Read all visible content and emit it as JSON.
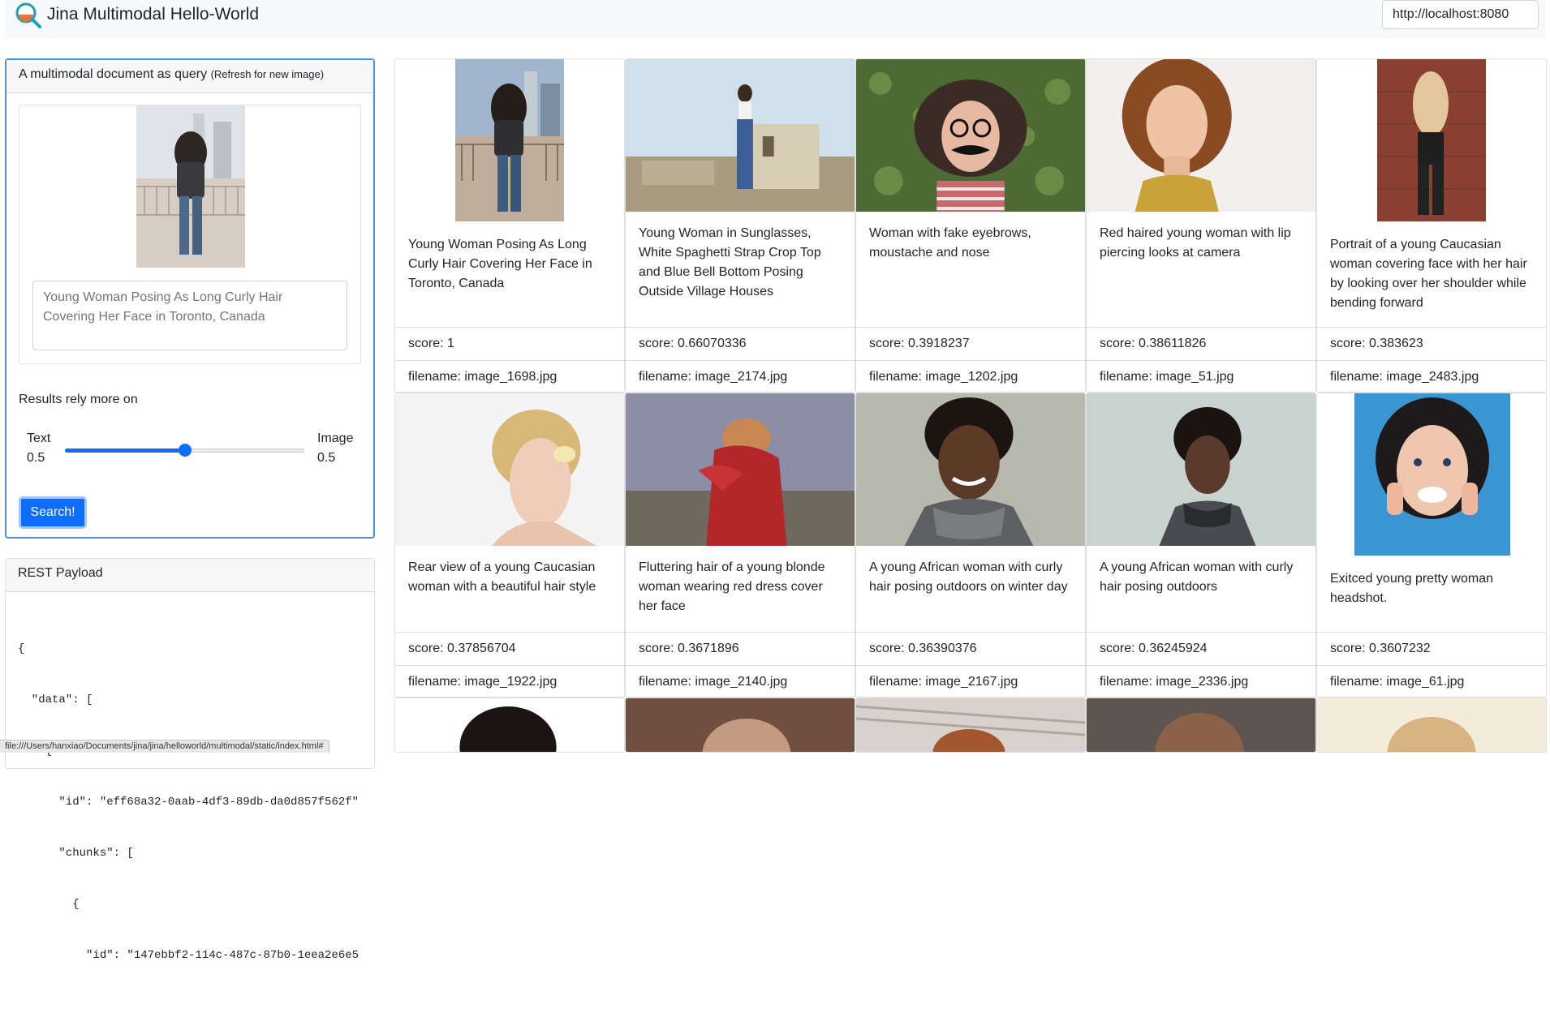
{
  "header": {
    "title": "Jina Multimodal Hello-World",
    "logo_icon": "magnifier-logo-icon",
    "url_value": "http://localhost:8080"
  },
  "query": {
    "title": "A multimodal document as query",
    "refresh_hint": "(Refresh for new image)",
    "text_placeholder": "Young Woman Posing As Long Curly Hair Covering Her Face in Toronto, Canada",
    "rely_label": "Results rely more on",
    "text_label": "Text",
    "text_weight": "0.5",
    "image_label": "Image",
    "image_weight": "0.5",
    "slider_value": 0.5,
    "search_label": "Search!"
  },
  "rest": {
    "title": "REST Payload",
    "lines": [
      "{",
      "  \"data\": [",
      "    {",
      "      \"id\": \"eff68a32-0aab-4df3-89db-da0d857f562f\"",
      "      \"chunks\": [",
      "        {",
      "          \"id\": \"147ebbf2-114c-487c-87b0-1eea2e6e5"
    ]
  },
  "status_url": "file:///Users/hanxiao/Documents/jina/jina/helloworld/multimodal/static/index.html#",
  "results": [
    {
      "caption": "Young Woman Posing As Long Curly Hair Covering Her Face in Toronto, Canada",
      "score": "score: 1",
      "filename": "filename: image_1698.jpg"
    },
    {
      "caption": "Young Woman in Sunglasses, White Spaghetti Strap Crop Top and Blue Bell Bottom Posing Outside Village Houses",
      "score": "score: 0.66070336",
      "filename": "filename: image_2174.jpg"
    },
    {
      "caption": "Woman with fake eyebrows, moustache and nose",
      "score": "score: 0.3918237",
      "filename": "filename: image_1202.jpg"
    },
    {
      "caption": "Red haired young woman with lip piercing looks at camera",
      "score": "score: 0.38611826",
      "filename": "filename: image_51.jpg"
    },
    {
      "caption": "Portrait of a young Caucasian woman covering face with her hair by looking over her shoulder while bending forward",
      "score": "score: 0.383623",
      "filename": "filename: image_2483.jpg"
    },
    {
      "caption": "Rear view of a young Caucasian woman with a beautiful hair style",
      "score": "score: 0.37856704",
      "filename": "filename: image_1922.jpg"
    },
    {
      "caption": "Fluttering hair of a young blonde woman wearing red dress cover her face",
      "score": "score: 0.3671896",
      "filename": "filename: image_2140.jpg"
    },
    {
      "caption": "A young African woman with curly hair posing outdoors on winter day",
      "score": "score: 0.36390376",
      "filename": "filename: image_2167.jpg"
    },
    {
      "caption": "A young African woman with curly hair posing outdoors",
      "score": "score: 0.36245924",
      "filename": "filename: image_2336.jpg"
    },
    {
      "caption": "Exitced young pretty woman headshot.",
      "score": "score: 0.3607232",
      "filename": "filename: image_61.jpg"
    }
  ]
}
